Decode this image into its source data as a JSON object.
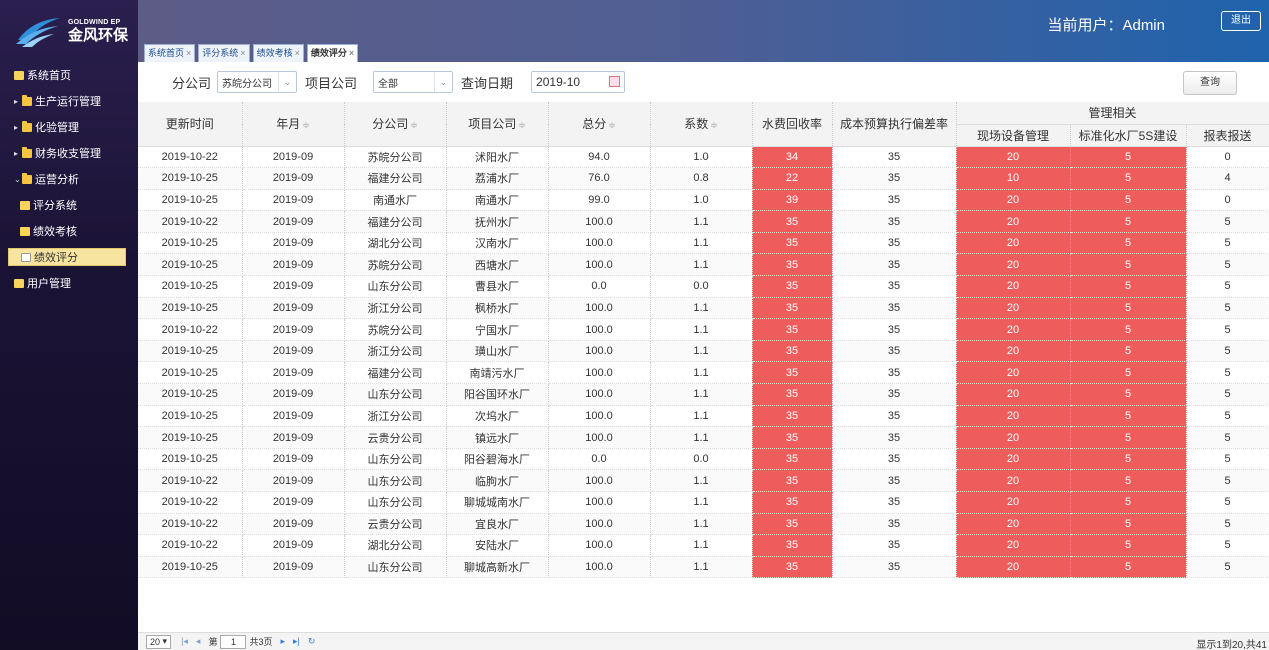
{
  "brand": {
    "en": "GOLDWIND EP",
    "cn": "金风环保"
  },
  "header": {
    "user_label": "当前用户：Admin",
    "logout": "退出"
  },
  "tabs": [
    {
      "label": "系统首页"
    },
    {
      "label": "评分系统"
    },
    {
      "label": "绩效考核"
    },
    {
      "label": "绩效评分"
    }
  ],
  "sidebar": {
    "items": [
      {
        "label": "系统首页"
      },
      {
        "label": "生产运行管理"
      },
      {
        "label": "化验管理"
      },
      {
        "label": "财务收支管理"
      },
      {
        "label": "运营分析"
      },
      {
        "label": "评分系统"
      },
      {
        "label": "绩效考核"
      },
      {
        "label": "绩效评分"
      },
      {
        "label": "用户管理"
      }
    ]
  },
  "filter": {
    "branch_label": "分公司",
    "branch_value": "苏皖分公司",
    "project_label": "项目公司",
    "project_value": "全部",
    "date_label": "查询日期",
    "date_value": "2019-10",
    "query_button": "查询"
  },
  "table": {
    "headers": {
      "update_time": "更新时间",
      "month": "年月",
      "branch": "分公司",
      "project": "项目公司",
      "total": "总分",
      "coef": "系数",
      "water_fee": "水费回收率",
      "budget": "成本预算执行偏差率",
      "mgmt_group": "管理相关",
      "equipment": "现场设备管理",
      "standard": "标准化水厂5S建设",
      "report": "报表报送"
    },
    "sort_mark": "≑",
    "rows": [
      [
        "2019-10-22",
        "2019-09",
        "苏皖分公司",
        "沭阳水厂",
        "94.0",
        "1.0",
        "34",
        "35",
        "20",
        "5",
        "0"
      ],
      [
        "2019-10-25",
        "2019-09",
        "福建分公司",
        "荔浦水厂",
        "76.0",
        "0.8",
        "22",
        "35",
        "10",
        "5",
        "4"
      ],
      [
        "2019-10-25",
        "2019-09",
        "南通水厂",
        "南通水厂",
        "99.0",
        "1.0",
        "39",
        "35",
        "20",
        "5",
        "0"
      ],
      [
        "2019-10-22",
        "2019-09",
        "福建分公司",
        "抚州水厂",
        "100.0",
        "1.1",
        "35",
        "35",
        "20",
        "5",
        "5"
      ],
      [
        "2019-10-25",
        "2019-09",
        "湖北分公司",
        "汉南水厂",
        "100.0",
        "1.1",
        "35",
        "35",
        "20",
        "5",
        "5"
      ],
      [
        "2019-10-25",
        "2019-09",
        "苏皖分公司",
        "西塘水厂",
        "100.0",
        "1.1",
        "35",
        "35",
        "20",
        "5",
        "5"
      ],
      [
        "2019-10-25",
        "2019-09",
        "山东分公司",
        "曹县水厂",
        "0.0",
        "0.0",
        "35",
        "35",
        "20",
        "5",
        "5"
      ],
      [
        "2019-10-25",
        "2019-09",
        "浙江分公司",
        "枫桥水厂",
        "100.0",
        "1.1",
        "35",
        "35",
        "20",
        "5",
        "5"
      ],
      [
        "2019-10-22",
        "2019-09",
        "苏皖分公司",
        "宁国水厂",
        "100.0",
        "1.1",
        "35",
        "35",
        "20",
        "5",
        "5"
      ],
      [
        "2019-10-25",
        "2019-09",
        "浙江分公司",
        "璜山水厂",
        "100.0",
        "1.1",
        "35",
        "35",
        "20",
        "5",
        "5"
      ],
      [
        "2019-10-25",
        "2019-09",
        "福建分公司",
        "南靖污水厂",
        "100.0",
        "1.1",
        "35",
        "35",
        "20",
        "5",
        "5"
      ],
      [
        "2019-10-25",
        "2019-09",
        "山东分公司",
        "阳谷国环水厂",
        "100.0",
        "1.1",
        "35",
        "35",
        "20",
        "5",
        "5"
      ],
      [
        "2019-10-25",
        "2019-09",
        "浙江分公司",
        "次坞水厂",
        "100.0",
        "1.1",
        "35",
        "35",
        "20",
        "5",
        "5"
      ],
      [
        "2019-10-25",
        "2019-09",
        "云贵分公司",
        "镇远水厂",
        "100.0",
        "1.1",
        "35",
        "35",
        "20",
        "5",
        "5"
      ],
      [
        "2019-10-25",
        "2019-09",
        "山东分公司",
        "阳谷碧海水厂",
        "0.0",
        "0.0",
        "35",
        "35",
        "20",
        "5",
        "5"
      ],
      [
        "2019-10-22",
        "2019-09",
        "山东分公司",
        "临朐水厂",
        "100.0",
        "1.1",
        "35",
        "35",
        "20",
        "5",
        "5"
      ],
      [
        "2019-10-22",
        "2019-09",
        "山东分公司",
        "聊城城南水厂",
        "100.0",
        "1.1",
        "35",
        "35",
        "20",
        "5",
        "5"
      ],
      [
        "2019-10-22",
        "2019-09",
        "云贵分公司",
        "宜良水厂",
        "100.0",
        "1.1",
        "35",
        "35",
        "20",
        "5",
        "5"
      ],
      [
        "2019-10-22",
        "2019-09",
        "湖北分公司",
        "安陆水厂",
        "100.0",
        "1.1",
        "35",
        "35",
        "20",
        "5",
        "5"
      ],
      [
        "2019-10-25",
        "2019-09",
        "山东分公司",
        "聊城高新水厂",
        "100.0",
        "1.1",
        "35",
        "35",
        "20",
        "5",
        "5"
      ]
    ]
  },
  "pager": {
    "page_size": "20",
    "page_label": "第",
    "page_value": "1",
    "total_pages": "共3页",
    "info": "显示1到20,共41"
  }
}
